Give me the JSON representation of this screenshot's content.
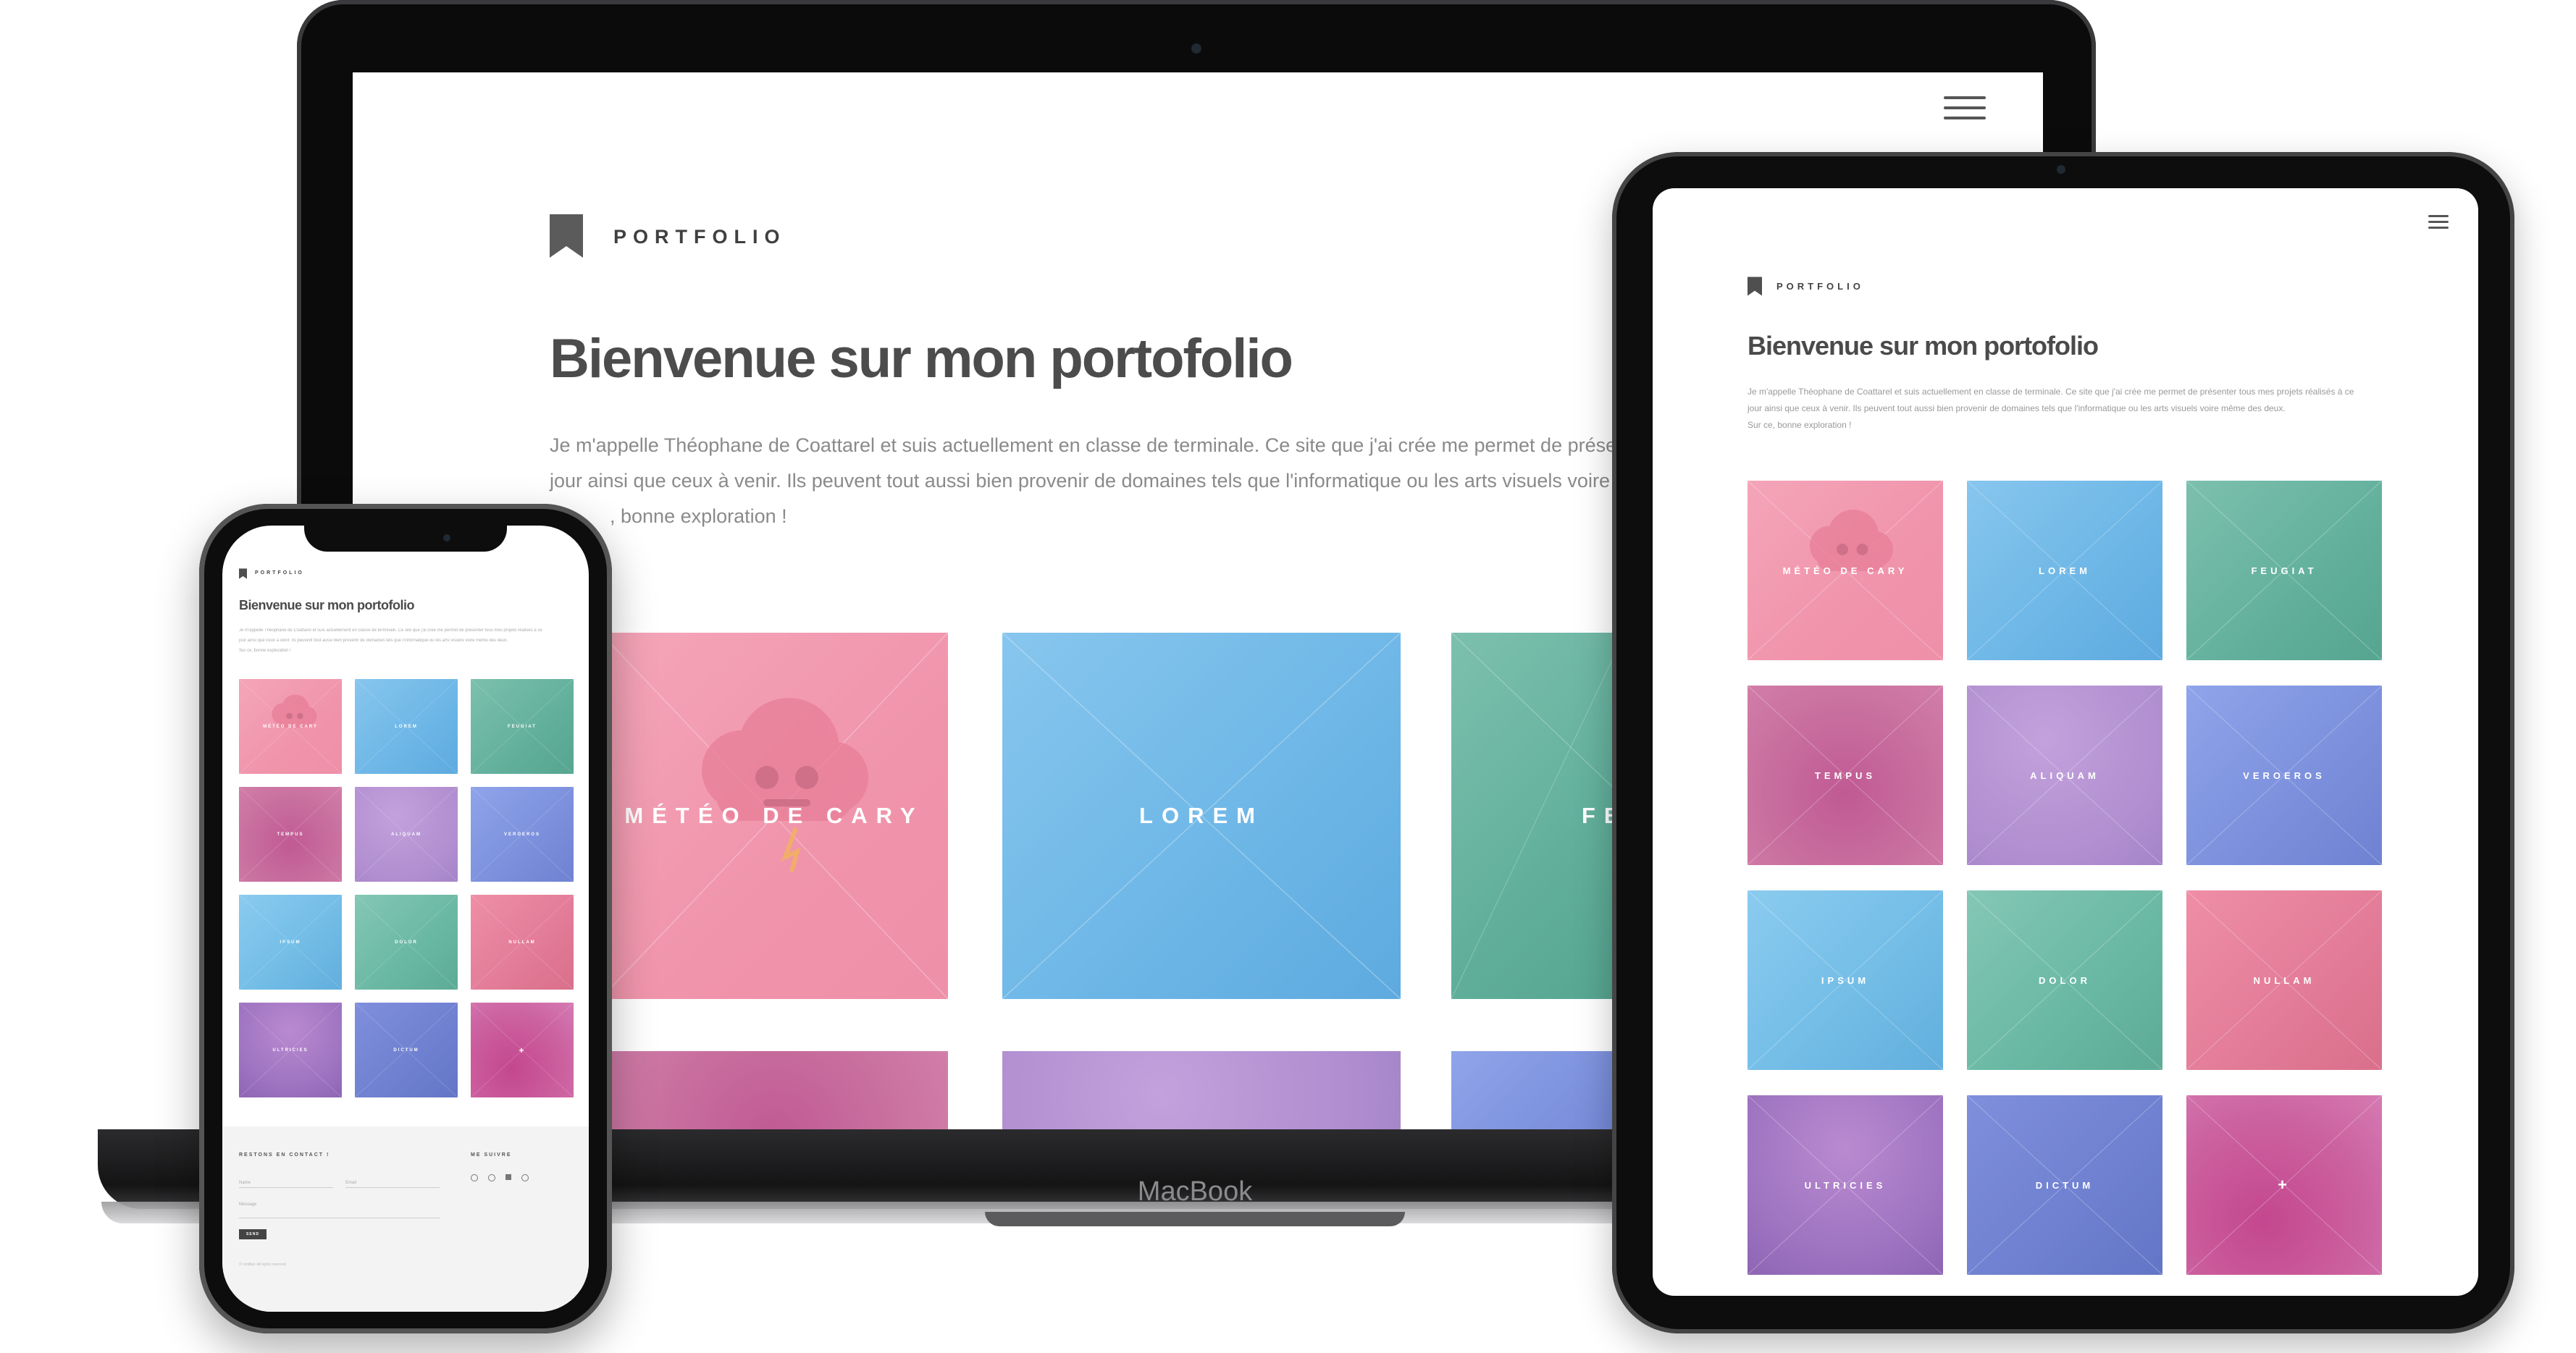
{
  "portfolio": {
    "brand_label": "PORTFOLIO",
    "heading": "Bienvenue sur mon portofolio",
    "intro_lines": [
      "Je m'appelle Théophane de Coattarel et suis actuellement en classe de terminale. Ce site que j'ai crée me permet de présenter tous mes projets réalisés à ce",
      "jour ainsi que ceux à venir. Ils peuvent tout aussi bien provenir de domaines tels que l'informatique ou les arts visuels voire même des deux.",
      "Sur ce, bonne exploration !"
    ],
    "laptop_intro_lines": [
      "Je m'appelle Théophane de Coattarel et suis actuellement en classe de terminale. Ce site que j'ai crée me permet de présenter to",
      "jour ainsi que ceux à venir. Ils peuvent tout aussi bien provenir de domaines tels que l'informatique ou les arts visuels voire même",
      ", bonne exploration !"
    ],
    "tiles": [
      {
        "label": "MÉTÉO DE CARY",
        "theme": "pink"
      },
      {
        "label": "LOREM",
        "theme": "blue"
      },
      {
        "label": "FEUGIAT",
        "theme": "teal"
      },
      {
        "label": "TEMPUS",
        "theme": "magenta"
      },
      {
        "label": "ALIQUAM",
        "theme": "lilac"
      },
      {
        "label": "VEROEROS",
        "theme": "periw"
      },
      {
        "label": "IPSUM",
        "theme": "sky"
      },
      {
        "label": "DOLOR",
        "theme": "mint"
      },
      {
        "label": "NULLAM",
        "theme": "rose"
      },
      {
        "label": "ULTRICIES",
        "theme": "violet"
      },
      {
        "label": "DICTUM",
        "theme": "indigo"
      },
      {
        "label": "+",
        "theme": "plus"
      }
    ],
    "laptop_partial_label": "FE"
  },
  "devices": {
    "laptop_brand": "MacBook"
  },
  "phone_footer": {
    "contact_heading": "RESTONS EN CONTACT !",
    "follow_heading": "ME SUIVRE",
    "name_placeholder": "Name",
    "email_placeholder": "Email",
    "message_placeholder": "Message",
    "send_label": "SEND",
    "copyright": "© Untitled. All rights reserved."
  },
  "icons": {
    "brand": "bookmark-icon",
    "menu": "hamburger-menu-icon",
    "cloud": "angry-cloud-icon"
  }
}
